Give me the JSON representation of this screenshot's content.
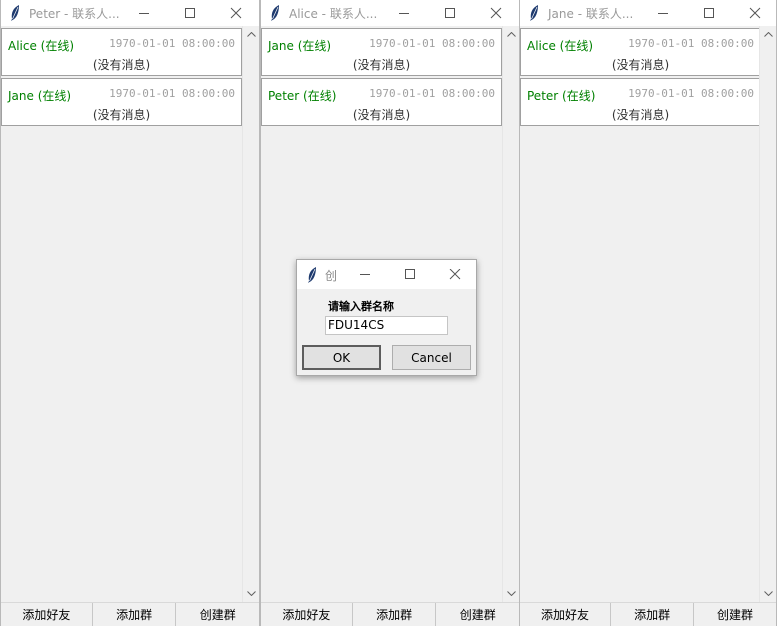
{
  "windows": [
    {
      "title": "Peter - 联系人...",
      "contacts": [
        {
          "name": "Alice (在线)",
          "time": "1970-01-01 08:00:00",
          "message": "(没有消息)"
        },
        {
          "name": "Jane (在线)",
          "time": "1970-01-01 08:00:00",
          "message": "(没有消息)"
        }
      ],
      "buttons": [
        "添加好友",
        "添加群",
        "创建群"
      ]
    },
    {
      "title": "Alice - 联系人...",
      "contacts": [
        {
          "name": "Jane (在线)",
          "time": "1970-01-01 08:00:00",
          "message": "(没有消息)"
        },
        {
          "name": "Peter (在线)",
          "time": "1970-01-01 08:00:00",
          "message": "(没有消息)"
        }
      ],
      "buttons": [
        "添加好友",
        "添加群",
        "创建群"
      ]
    },
    {
      "title": "Jane - 联系人...",
      "contacts": [
        {
          "name": "Alice (在线)",
          "time": "1970-01-01 08:00:00",
          "message": "(没有消息)"
        },
        {
          "name": "Peter (在线)",
          "time": "1970-01-01 08:00:00",
          "message": "(没有消息)"
        }
      ],
      "buttons": [
        "添加好友",
        "添加群",
        "创建群"
      ]
    }
  ],
  "dialog": {
    "title": "创",
    "prompt": "请输入群名称",
    "input_value": "FDU14CS",
    "ok_label": "OK",
    "cancel_label": "Cancel"
  },
  "icons": {
    "app": "feather-icon",
    "minimize": "minimize-icon",
    "maximize": "maximize-icon",
    "close": "close-icon",
    "scroll_up": "arrow-up-icon",
    "scroll_down": "arrow-down-icon"
  },
  "colors": {
    "online_name": "#008000",
    "timestamp": "#a0a0a0",
    "title_text": "#999999"
  }
}
